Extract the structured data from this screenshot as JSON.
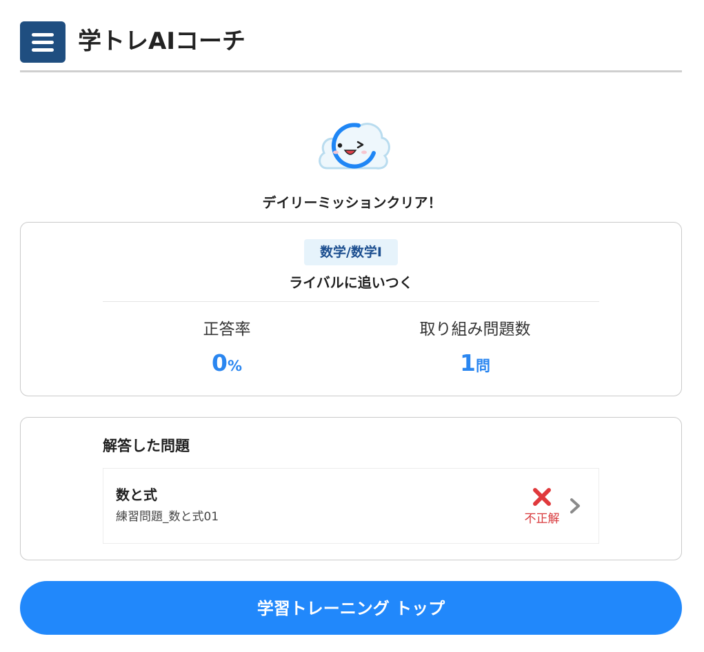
{
  "header": {
    "menu_icon": "hamburger-menu-icon",
    "title": "学トレAIコーチ"
  },
  "mascot": {
    "icon": "smiling-cloud-mascot-icon"
  },
  "mission": {
    "status": "デイリーミッションクリア！",
    "subject": "数学/数学Ⅰ",
    "name": "ライバルに追いつく"
  },
  "stats": {
    "accuracy": {
      "label": "正答率",
      "value": "0",
      "unit": "%"
    },
    "attempted": {
      "label": "取り組み問題数",
      "value": "1",
      "unit": "問"
    }
  },
  "answered": {
    "heading": "解答した問題",
    "items": [
      {
        "topic": "数と式",
        "problem": "練習問題_数と式01",
        "result_label": "不正解",
        "result_icon": "cross-icon"
      }
    ]
  },
  "footer": {
    "button_label": "学習トレーニング トップ"
  },
  "colors": {
    "menu_bg": "#1f4e80",
    "accent_blue": "#2a86f0",
    "button_blue": "#2188fb",
    "badge_bg": "#e6f3fb",
    "badge_text": "#1b4e8f",
    "incorrect_red": "#d8393c"
  }
}
